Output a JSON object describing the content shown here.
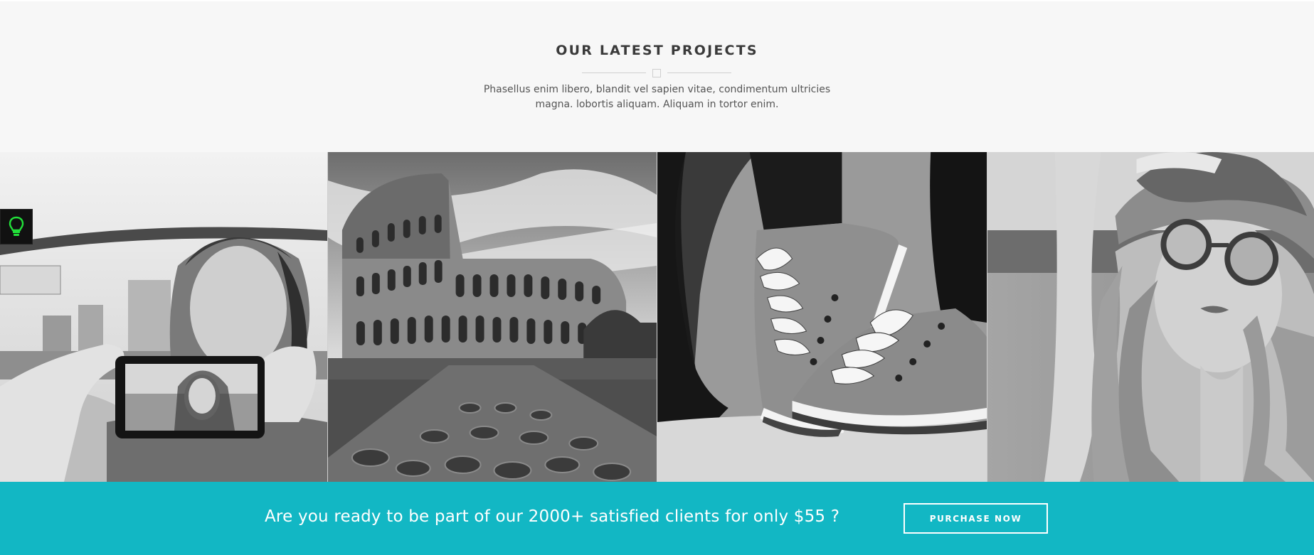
{
  "projects": {
    "title": "OUR LATEST PROJECTS",
    "description_line1": "Phasellus enim libero, blandit vel sapien vitae, condimentum ultricies",
    "description_line2": "magna. lobortis aliquam. Aliquam in tortor enim."
  },
  "gallery": {
    "items": [
      {
        "subject": "woman-selfie-phone"
      },
      {
        "subject": "colosseum"
      },
      {
        "subject": "sneakers"
      },
      {
        "subject": "woman-sunglasses-hat"
      }
    ]
  },
  "side_tool": {
    "icon": "lightbulb-icon",
    "color": "#22e03a"
  },
  "cta": {
    "text": "Are you ready to be part of our 2000+ satisfied clients for only $55 ?",
    "button_label": "PURCHASE NOW",
    "background": "#12b7c4"
  }
}
